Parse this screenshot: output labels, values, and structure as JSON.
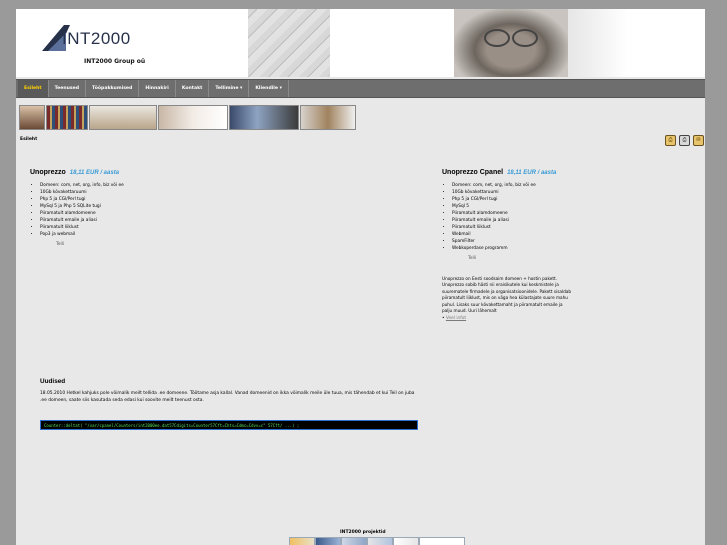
{
  "header": {
    "logo_text": "INT2000",
    "group_name": "INT2000 Group oü"
  },
  "nav": {
    "items": [
      {
        "label": "Esileht",
        "active": true
      },
      {
        "label": "Teenused"
      },
      {
        "label": "Tööpakkumised"
      },
      {
        "label": "Hinnakiri"
      },
      {
        "label": "Kontakt"
      },
      {
        "label": "Tellimine ▾"
      },
      {
        "label": "Kliendile ▾"
      }
    ]
  },
  "breadcrumb": "Esileht",
  "packages": [
    {
      "title": "Unoprezzo",
      "price": "18,11 EUR / aasta",
      "features": [
        "Domeen: com, net, org, info, biz või ee",
        "10Gb kõvakettaruumi",
        "Php 5 ja CGI/Perl tugi",
        "MySql 5 ja Php 5 SQLite tugi",
        "Piiramatult alamdomeene",
        "Piiramatult emaile ja aliasi",
        "Piiramatult liiklust",
        "Pop3 ja webmail"
      ],
      "order_label": "Telli"
    },
    {
      "title": "Unoprezzo Cpanel",
      "price": "18,11 EUR / aasta",
      "features": [
        "Domeen: com, net, org, info, biz või ee",
        "10Gb kõvakettaruumi",
        "Php 5 ja CGI/Perl tugi",
        "MySql 5",
        "Piiramatult alamdomeene",
        "Piiramatult emaile ja aliasi",
        "Piiramatult liiklust",
        "Webmail",
        "SpamFilter",
        "Webkoperdase programm"
      ],
      "order_label": "Telli",
      "description": "Unoprezzo on Eesti soodsaim domeen + hostin pakett. Unoprezzo sobib hästi nii eraisikutele kui keskmistele ja suurematele firmadele ja organisatsioonidele. Pakett sisaldab piiramatult liiklust, mis on väga hea külastajate suure mahu puhul. Lisaks suur kõvakettamaht ja piiramatult emaile ja palju muud. Uuri lähemalt",
      "more_label": "Veel infot"
    }
  ],
  "news": {
    "title": "Uudised",
    "text": "18.05.2010 Hetkel kahjuks pole võimalik meilt tellida .ee domeene. Töötame asja kallal. Vanad domeenid on ikka võimalik meile üle tuua, mis tähendab et kui Teil on juba .ee domeen, saate siis kasutada seda edasi kui soovite meilt teenust osta.",
    "code": "Counter::deltat( \"/var/cpanel/Counters/int2000ee.dat57Cdigits=Counter57Cft=Chts=Cdmc=Cdvv=c\" 57Cft/ ...) ;"
  },
  "footer": {
    "projects_title": "INT2000 projektid"
  },
  "colors": {
    "nav_bg": "#6e6e6e",
    "nav_active": "#ffd200",
    "price": "#3a9bd6",
    "code_text": "#57e35f"
  }
}
